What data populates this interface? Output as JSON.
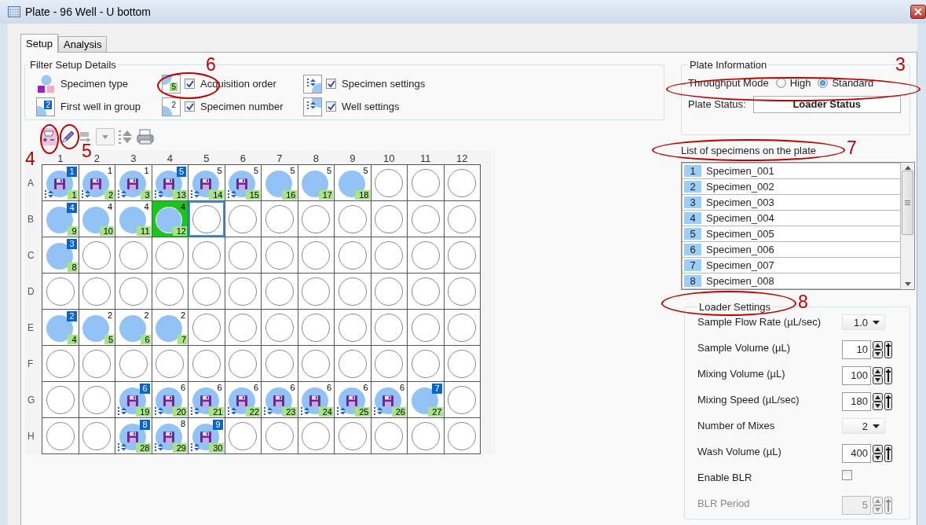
{
  "window": {
    "title": "Plate - 96 Well - U bottom"
  },
  "tabs": [
    {
      "label": "Setup",
      "selected": true
    },
    {
      "label": "Analysis",
      "selected": false
    }
  ],
  "filter_setup": {
    "title": "Filter Setup Details",
    "items": [
      {
        "kind": "legend",
        "label": "Specimen type"
      },
      {
        "kind": "checkbox",
        "label": "Acquisition order",
        "checked": true,
        "sample": "5"
      },
      {
        "kind": "checkbox",
        "label": "Specimen settings",
        "checked": true
      },
      {
        "kind": "legend",
        "label": "First well in group",
        "sample": "2"
      },
      {
        "kind": "checkbox",
        "label": "Specimen number",
        "checked": true,
        "sample": "2"
      },
      {
        "kind": "checkbox",
        "label": "Well settings",
        "checked": true
      }
    ]
  },
  "plate": {
    "columns": [
      "1",
      "2",
      "3",
      "4",
      "5",
      "6",
      "7",
      "8",
      "9",
      "10",
      "11",
      "12"
    ],
    "rows": [
      {
        "label": "A",
        "wells": [
          {
            "kind": "saved",
            "group": "1",
            "first": true,
            "order": "1",
            "settings": true,
            "selected": false,
            "focused": false
          },
          {
            "kind": "saved",
            "group": "1",
            "first": false,
            "order": "2",
            "settings": true,
            "selected": false,
            "focused": false
          },
          {
            "kind": "saved",
            "group": "1",
            "first": false,
            "order": "3",
            "settings": true,
            "selected": false,
            "focused": false
          },
          {
            "kind": "saved",
            "group": "5",
            "first": true,
            "order": "13",
            "settings": true,
            "selected": false,
            "focused": false
          },
          {
            "kind": "saved",
            "group": "5",
            "first": false,
            "order": "14",
            "settings": true,
            "selected": false,
            "focused": false
          },
          {
            "kind": "saved",
            "group": "5",
            "first": false,
            "order": "15",
            "settings": true,
            "selected": false,
            "focused": false
          },
          {
            "kind": "specimen",
            "group": "5",
            "first": false,
            "order": "16",
            "settings": false,
            "selected": false,
            "focused": false
          },
          {
            "kind": "specimen",
            "group": "5",
            "first": false,
            "order": "17",
            "settings": false,
            "selected": false,
            "focused": false
          },
          {
            "kind": "specimen",
            "group": "5",
            "first": false,
            "order": "18",
            "settings": false,
            "selected": false,
            "focused": false
          },
          {
            "kind": "empty",
            "selected": false,
            "focused": false
          },
          {
            "kind": "empty",
            "selected": false,
            "focused": false
          },
          {
            "kind": "empty",
            "selected": false,
            "focused": false
          }
        ]
      },
      {
        "label": "B",
        "wells": [
          {
            "kind": "specimen",
            "group": "4",
            "first": true,
            "order": "9",
            "settings": false,
            "selected": false,
            "focused": false
          },
          {
            "kind": "specimen",
            "group": "4",
            "first": false,
            "order": "10",
            "settings": false,
            "selected": false,
            "focused": false
          },
          {
            "kind": "specimen",
            "group": "4",
            "first": false,
            "order": "11",
            "settings": false,
            "selected": false,
            "focused": false
          },
          {
            "kind": "specimen",
            "group": "4",
            "first": false,
            "order": "12",
            "settings": false,
            "selected": true,
            "focused": false
          },
          {
            "kind": "empty",
            "selected": false,
            "focused": true
          },
          {
            "kind": "empty",
            "selected": false,
            "focused": false
          },
          {
            "kind": "empty",
            "selected": false,
            "focused": false
          },
          {
            "kind": "empty",
            "selected": false,
            "focused": false
          },
          {
            "kind": "empty",
            "selected": false,
            "focused": false
          },
          {
            "kind": "empty",
            "selected": false,
            "focused": false
          },
          {
            "kind": "empty",
            "selected": false,
            "focused": false
          },
          {
            "kind": "empty",
            "selected": false,
            "focused": false
          }
        ]
      },
      {
        "label": "C",
        "wells": [
          {
            "kind": "specimen",
            "group": "3",
            "first": true,
            "order": "8",
            "settings": false,
            "selected": false,
            "focused": false
          },
          {
            "kind": "empty",
            "selected": false,
            "focused": false
          },
          {
            "kind": "empty",
            "selected": false,
            "focused": false
          },
          {
            "kind": "empty",
            "selected": false,
            "focused": false
          },
          {
            "kind": "empty",
            "selected": false,
            "focused": false
          },
          {
            "kind": "empty",
            "selected": false,
            "focused": false
          },
          {
            "kind": "empty",
            "selected": false,
            "focused": false
          },
          {
            "kind": "empty",
            "selected": false,
            "focused": false
          },
          {
            "kind": "empty",
            "selected": false,
            "focused": false
          },
          {
            "kind": "empty",
            "selected": false,
            "focused": false
          },
          {
            "kind": "empty",
            "selected": false,
            "focused": false
          },
          {
            "kind": "empty",
            "selected": false,
            "focused": false
          }
        ]
      },
      {
        "label": "D",
        "wells": [
          {
            "kind": "empty",
            "selected": false,
            "focused": false
          },
          {
            "kind": "empty",
            "selected": false,
            "focused": false
          },
          {
            "kind": "empty",
            "selected": false,
            "focused": false
          },
          {
            "kind": "empty",
            "selected": false,
            "focused": false
          },
          {
            "kind": "empty",
            "selected": false,
            "focused": false
          },
          {
            "kind": "empty",
            "selected": false,
            "focused": false
          },
          {
            "kind": "empty",
            "selected": false,
            "focused": false
          },
          {
            "kind": "empty",
            "selected": false,
            "focused": false
          },
          {
            "kind": "empty",
            "selected": false,
            "focused": false
          },
          {
            "kind": "empty",
            "selected": false,
            "focused": false
          },
          {
            "kind": "empty",
            "selected": false,
            "focused": false
          },
          {
            "kind": "empty",
            "selected": false,
            "focused": false
          }
        ]
      },
      {
        "label": "E",
        "wells": [
          {
            "kind": "specimen",
            "group": "2",
            "first": true,
            "order": "4",
            "settings": false,
            "selected": false,
            "focused": false
          },
          {
            "kind": "specimen",
            "group": "2",
            "first": false,
            "order": "5",
            "settings": false,
            "selected": false,
            "focused": false
          },
          {
            "kind": "specimen",
            "group": "2",
            "first": false,
            "order": "6",
            "settings": false,
            "selected": false,
            "focused": false
          },
          {
            "kind": "specimen",
            "group": "2",
            "first": false,
            "order": "7",
            "settings": false,
            "selected": false,
            "focused": false
          },
          {
            "kind": "empty",
            "selected": false,
            "focused": false
          },
          {
            "kind": "empty",
            "selected": false,
            "focused": false
          },
          {
            "kind": "empty",
            "selected": false,
            "focused": false
          },
          {
            "kind": "empty",
            "selected": false,
            "focused": false
          },
          {
            "kind": "empty",
            "selected": false,
            "focused": false
          },
          {
            "kind": "empty",
            "selected": false,
            "focused": false
          },
          {
            "kind": "empty",
            "selected": false,
            "focused": false
          },
          {
            "kind": "empty",
            "selected": false,
            "focused": false
          }
        ]
      },
      {
        "label": "F",
        "wells": [
          {
            "kind": "empty",
            "selected": false,
            "focused": false
          },
          {
            "kind": "empty",
            "selected": false,
            "focused": false
          },
          {
            "kind": "empty",
            "selected": false,
            "focused": false
          },
          {
            "kind": "empty",
            "selected": false,
            "focused": false
          },
          {
            "kind": "empty",
            "selected": false,
            "focused": false
          },
          {
            "kind": "empty",
            "selected": false,
            "focused": false
          },
          {
            "kind": "empty",
            "selected": false,
            "focused": false
          },
          {
            "kind": "empty",
            "selected": false,
            "focused": false
          },
          {
            "kind": "empty",
            "selected": false,
            "focused": false
          },
          {
            "kind": "empty",
            "selected": false,
            "focused": false
          },
          {
            "kind": "empty",
            "selected": false,
            "focused": false
          },
          {
            "kind": "empty",
            "selected": false,
            "focused": false
          }
        ]
      },
      {
        "label": "G",
        "wells": [
          {
            "kind": "empty",
            "selected": false,
            "focused": false
          },
          {
            "kind": "empty",
            "selected": false,
            "focused": false
          },
          {
            "kind": "saved",
            "group": "6",
            "first": true,
            "order": "19",
            "settings": true,
            "selected": false,
            "focused": false
          },
          {
            "kind": "saved",
            "group": "6",
            "first": false,
            "order": "20",
            "settings": true,
            "selected": false,
            "focused": false
          },
          {
            "kind": "saved",
            "group": "6",
            "first": false,
            "order": "21",
            "settings": true,
            "selected": false,
            "focused": false
          },
          {
            "kind": "saved",
            "group": "6",
            "first": false,
            "order": "22",
            "settings": true,
            "selected": false,
            "focused": false
          },
          {
            "kind": "saved",
            "group": "6",
            "first": false,
            "order": "23",
            "settings": true,
            "selected": false,
            "focused": false
          },
          {
            "kind": "saved",
            "group": "6",
            "first": false,
            "order": "24",
            "settings": true,
            "selected": false,
            "focused": false
          },
          {
            "kind": "saved",
            "group": "6",
            "first": false,
            "order": "25",
            "settings": true,
            "selected": false,
            "focused": false
          },
          {
            "kind": "saved",
            "group": "6",
            "first": false,
            "order": "26",
            "settings": true,
            "selected": false,
            "focused": false
          },
          {
            "kind": "specimen",
            "group": "7",
            "first": true,
            "order": "27",
            "settings": false,
            "selected": false,
            "focused": false
          },
          {
            "kind": "empty",
            "selected": false,
            "focused": false
          }
        ]
      },
      {
        "label": "H",
        "wells": [
          {
            "kind": "empty",
            "selected": false,
            "focused": false
          },
          {
            "kind": "empty",
            "selected": false,
            "focused": false
          },
          {
            "kind": "saved",
            "group": "8",
            "first": true,
            "order": "28",
            "settings": true,
            "selected": false,
            "focused": false
          },
          {
            "kind": "saved",
            "group": "8",
            "first": false,
            "order": "29",
            "settings": true,
            "selected": false,
            "focused": false
          },
          {
            "kind": "saved",
            "group": "9",
            "first": true,
            "order": "30",
            "settings": true,
            "selected": false,
            "focused": false
          },
          {
            "kind": "empty",
            "selected": false,
            "focused": false
          },
          {
            "kind": "empty",
            "selected": false,
            "focused": false
          },
          {
            "kind": "empty",
            "selected": false,
            "focused": false
          },
          {
            "kind": "empty",
            "selected": false,
            "focused": false
          },
          {
            "kind": "empty",
            "selected": false,
            "focused": false
          },
          {
            "kind": "empty",
            "selected": false,
            "focused": false
          },
          {
            "kind": "empty",
            "selected": false,
            "focused": false
          }
        ]
      }
    ]
  },
  "plate_information": {
    "title": "Plate Information",
    "throughput_label": "Throughput Mode",
    "options": [
      {
        "label": "High",
        "selected": false
      },
      {
        "label": "Standard",
        "selected": true
      }
    ],
    "status_label": "Plate Status:",
    "status": "Loader Status"
  },
  "specimen_list": {
    "title": "List of specimens on the plate",
    "items": [
      {
        "number": "1",
        "name": "Specimen_001"
      },
      {
        "number": "2",
        "name": "Specimen_002"
      },
      {
        "number": "3",
        "name": "Specimen_003"
      },
      {
        "number": "4",
        "name": "Specimen_004"
      },
      {
        "number": "5",
        "name": "Specimen_005"
      },
      {
        "number": "6",
        "name": "Specimen_006"
      },
      {
        "number": "7",
        "name": "Specimen_007"
      },
      {
        "number": "8",
        "name": "Specimen_008"
      }
    ]
  },
  "loader_settings": {
    "title": "Loader Settings",
    "rows": [
      {
        "kind": "dropdown",
        "label": "Sample Flow Rate (µL/sec)",
        "value": "1.0",
        "disabled": false
      },
      {
        "kind": "spin",
        "label": "Sample Volume (µL)",
        "value": "10",
        "disabled": false
      },
      {
        "kind": "spin",
        "label": "Mixing Volume (µL)",
        "value": "100",
        "disabled": false
      },
      {
        "kind": "spin",
        "label": "Mixing Speed (µL/sec)",
        "value": "180",
        "disabled": false
      },
      {
        "kind": "dropdown",
        "label": "Number of Mixes",
        "value": "2",
        "disabled": false
      },
      {
        "kind": "spin",
        "label": "Wash Volume (µL)",
        "value": "400",
        "disabled": false
      },
      {
        "kind": "checkbox",
        "label": "Enable BLR",
        "checked": false,
        "disabled": false
      },
      {
        "kind": "spin",
        "label": "BLR Period",
        "value": "5",
        "disabled": true
      }
    ]
  },
  "annotations": [
    {
      "label": "6"
    },
    {
      "label": "3"
    },
    {
      "label": "4"
    },
    {
      "label": "5"
    },
    {
      "label": "7"
    },
    {
      "label": "8"
    }
  ]
}
